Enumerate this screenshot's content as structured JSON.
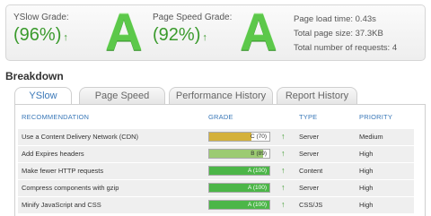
{
  "summary": {
    "yslow_label": "YSlow Grade:",
    "yslow_pct": "(96%)",
    "yslow_letter": "A",
    "pagespeed_label": "Page Speed Grade:",
    "pagespeed_pct": "(92%)",
    "pagespeed_letter": "A",
    "arrow": "↑",
    "load_time": "Page load time: 0.43s",
    "page_size": "Total page size: 37.3KB",
    "requests": "Total number of requests: 4"
  },
  "breakdown": {
    "title": "Breakdown",
    "tabs": [
      "YSlow",
      "Page Speed",
      "Performance History",
      "Report History"
    ],
    "active_tab": 0,
    "columns": {
      "recommendation": "RECOMMENDATION",
      "grade": "GRADE",
      "type": "TYPE",
      "priority": "PRIORITY"
    },
    "rows": [
      {
        "recommendation": "Use a Content Delivery Network (CDN)",
        "grade": "C (70)",
        "score": 70,
        "color": "#d4b13a",
        "type": "Server",
        "priority": "Medium"
      },
      {
        "recommendation": "Add Expires headers",
        "grade": "B (89)",
        "score": 89,
        "color": "#9ccb72",
        "type": "Server",
        "priority": "High"
      },
      {
        "recommendation": "Make fewer HTTP requests",
        "grade": "A (100)",
        "score": 100,
        "color": "#4cb648",
        "type": "Content",
        "priority": "High"
      },
      {
        "recommendation": "Compress components with gzip",
        "grade": "A (100)",
        "score": 100,
        "color": "#4cb648",
        "type": "Server",
        "priority": "High"
      },
      {
        "recommendation": "Minify JavaScript and CSS",
        "grade": "A (100)",
        "score": 100,
        "color": "#4cb648",
        "type": "CSS/JS",
        "priority": "High"
      }
    ]
  }
}
